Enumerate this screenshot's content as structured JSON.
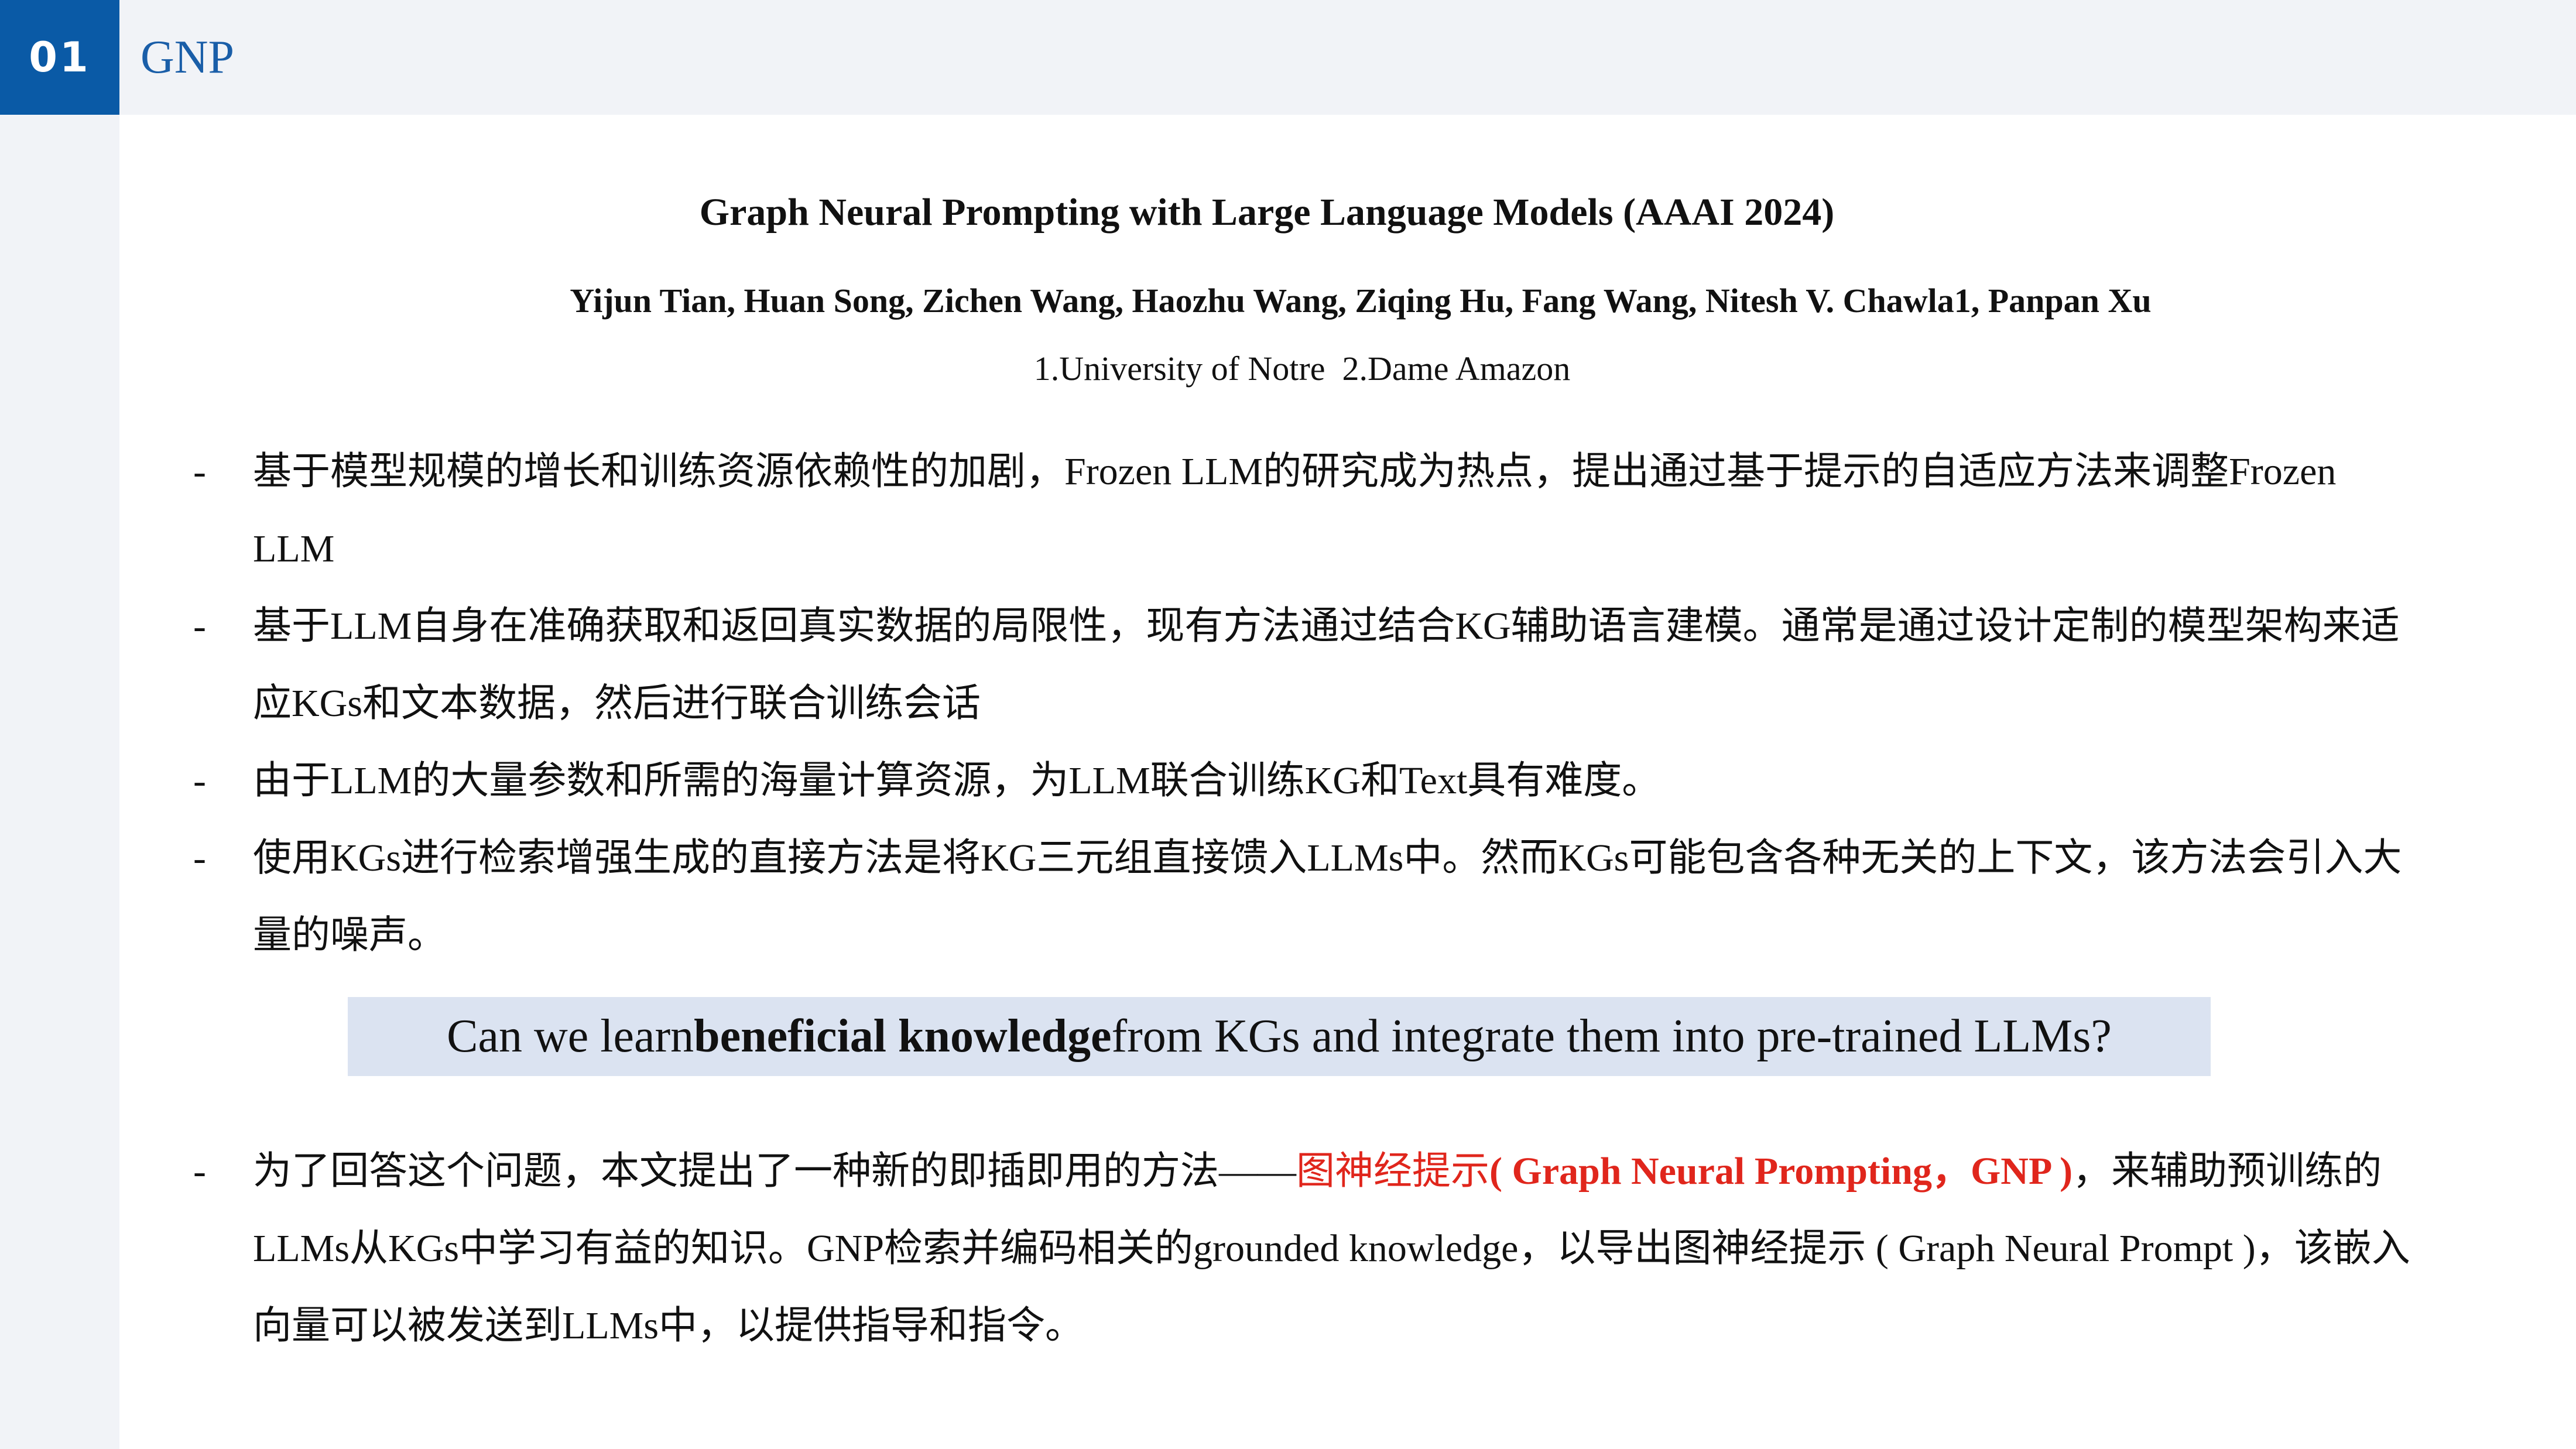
{
  "header": {
    "section_number": "01",
    "section_title": "GNP"
  },
  "paper": {
    "title": "Graph Neural Prompting with Large Language Models (AAAI 2024)",
    "authors": "Yijun Tian, Huan Song, Zichen Wang, Haozhu Wang, Ziqing Hu, Fang Wang, Nitesh V. Chawla1, Panpan Xu",
    "affiliations": "1.University of Notre  2.Dame Amazon"
  },
  "bullets": [
    {
      "dash": "-",
      "text": "基于模型规模的增长和训练资源依赖性的加剧，Frozen LLM的研究成为热点，提出通过基于提示的自适应方法来调整Frozen LLM"
    },
    {
      "dash": "-",
      "text": "基于LLM自身在准确获取和返回真实数据的局限性，现有方法通过结合KG辅助语言建模。通常是通过设计定制的模型架构来适应KGs和文本数据，然后进行联合训练会话"
    },
    {
      "dash": "-",
      "text": "由于LLM的大量参数和所需的海量计算资源，为LLM联合训练KG和Text具有难度。"
    },
    {
      "dash": "-",
      "text": "使用KGs进行检索增强生成的直接方法是将KG三元组直接馈入LLMs中。然而KGs可能包含各种无关的上下文，该方法会引入大量的噪声。"
    }
  ],
  "question": {
    "before": "Can we learn ",
    "bold": "beneficial knowledge",
    "after": " from KGs and integrate them into pre-trained LLMs?"
  },
  "final_bullet": {
    "dash": "-",
    "before": "为了回答这个问题，本文提出了一种新的即插即用的方法——",
    "red_cn": "图神经提示",
    "red_en": "( Graph Neural Prompting，GNP )",
    "after": "，来辅助预训练的LLMs从KGs中学习有益的知识。GNP检索并编码相关的grounded knowledge，以导出图神经提示 ( Graph Neural Prompt )，该嵌入向量可以被发送到LLMs中，以提供指导和指令。"
  },
  "colors": {
    "accent_blue": "#0a5aa6",
    "title_blue": "#1a5ea8",
    "highlight_red": "#e0261c",
    "question_bg": "#dbe3f1",
    "bar_bg": "#f1f3f7"
  }
}
